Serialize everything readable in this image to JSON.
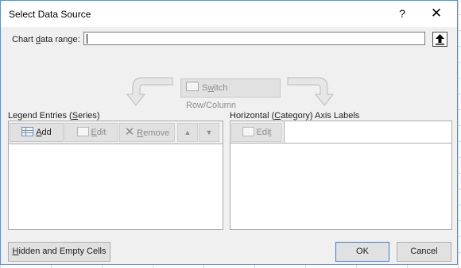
{
  "dialog": {
    "title": "Select Data Source",
    "help_label": "?",
    "close_label": "✕"
  },
  "range": {
    "label_pre": "Chart ",
    "label_key": "d",
    "label_post": "ata range:",
    "value": "",
    "collapse_label": "🡅"
  },
  "switch_button": {
    "pre": "S",
    "key": "w",
    "post": "itch Row/Column"
  },
  "legend": {
    "label_pre": "Legend Entries (",
    "label_key": "S",
    "label_post": "eries)",
    "add": {
      "key": "A",
      "post": "dd"
    },
    "edit": {
      "key": "E",
      "post": "dit"
    },
    "remove": {
      "key": "R",
      "post": "emove"
    },
    "up_label": "▲",
    "down_label": "▼"
  },
  "axis": {
    "label_pre": "Horizontal (",
    "label_key": "C",
    "label_post": "ategory) Axis Labels",
    "edit": {
      "pre": "Edi",
      "key": "t",
      "post": ""
    }
  },
  "footer": {
    "hidden": {
      "key": "H",
      "post": "idden and Empty Cells"
    },
    "ok_label": "OK",
    "cancel_label": "Cancel"
  }
}
